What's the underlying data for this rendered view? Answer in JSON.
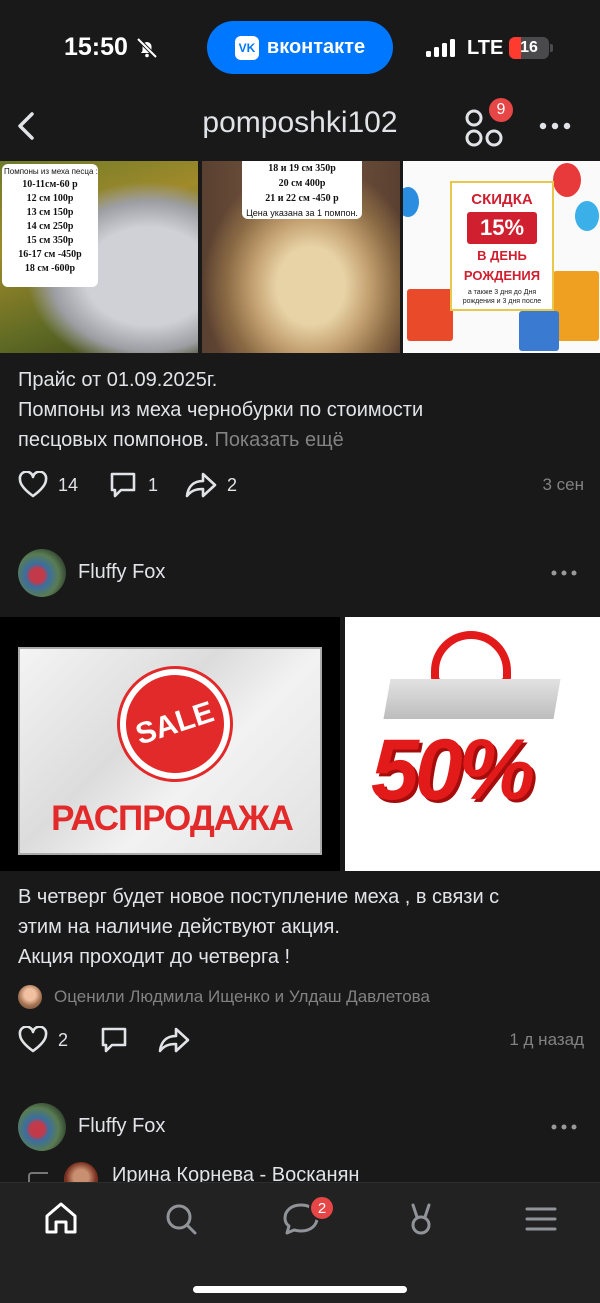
{
  "status_bar": {
    "time": "15:50",
    "app_pill_label": "вконтакте",
    "app_pill_logo": "VK",
    "network": "LTE",
    "battery": "16"
  },
  "header": {
    "title": "pomposhki102",
    "apps_badge": "9"
  },
  "post1": {
    "photo1": {
      "title": "Помпоны из меха песца :",
      "lines": [
        "10-11см-60 р",
        "12 см 100р",
        "13 см 150р",
        "14 см 250р",
        "15 см 350р",
        "16-17 см -450р",
        "18 см -600р"
      ]
    },
    "photo2": {
      "lines": [
        "18 и 19 см 350р",
        "20 см 400р",
        "21 и 22 см -450 р"
      ],
      "note": "Цена указана за 1 помпон."
    },
    "photo3": {
      "top": "СКИДКА",
      "percent": "15%",
      "line1": "В ДЕНЬ",
      "line2": "РОЖДЕНИЯ",
      "small": "а также 3 дня до Дня рождения и 3 дня после"
    },
    "text_line1": "Прайс от 01.09.2025г.",
    "text_line2": "Помпоны из меха чернобурки по стоимости",
    "text_line3": "песцовых помпонов.",
    "show_more": "Показать ещё",
    "likes": "14",
    "comments": "1",
    "shares": "2",
    "date": "3 сен"
  },
  "post2": {
    "author": "Fluffy Fox",
    "photo1_seal": "SALE",
    "photo1_word": "РАСПРОДАЖА",
    "photo2_text": "50%",
    "text_line1": "В четверг будет новое поступление меха , в связи с",
    "text_line2": "этим на наличие действуют акция.",
    "text_line3": "Акция проходит до четверга !",
    "liked_by": "Оценили Людмила Ищенко и Улдаш Давлетова",
    "likes": "2",
    "date": "1 д назад"
  },
  "post3": {
    "author": "Fluffy Fox",
    "repost_name": "Ирина Корнева - Восканян"
  },
  "tabbar": {
    "messages_badge": "2"
  }
}
